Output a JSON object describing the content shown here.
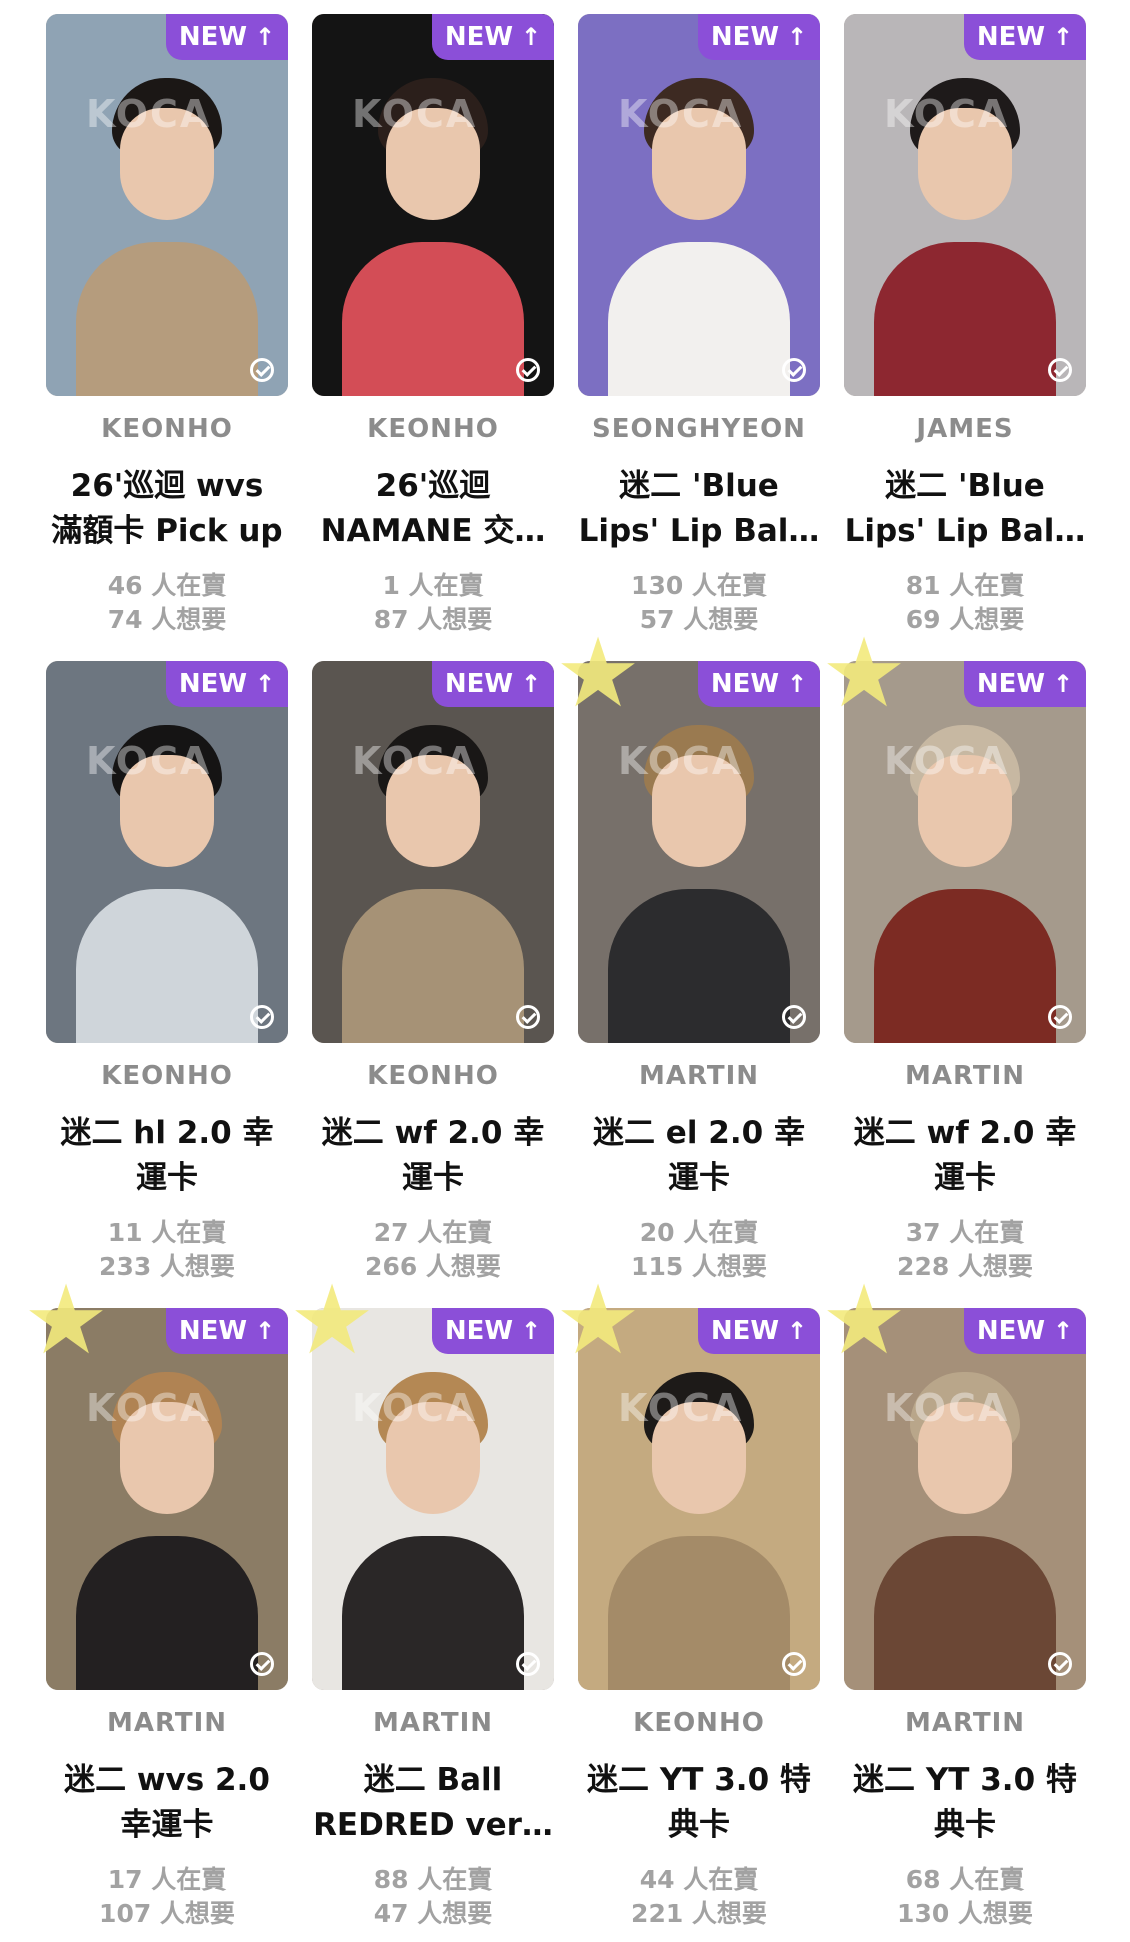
{
  "cards": [
    {
      "member": "KEONHO",
      "title": "26'巡迴 wvs\n滿額卡 Pick up",
      "selling": "46 人在賣",
      "wanting": "74 人想要",
      "badge": "NEW",
      "star": false,
      "palette": {
        "bg": "#8fa3b4",
        "hair": "#1b1715",
        "body": "#b59c7d"
      }
    },
    {
      "member": "KEONHO",
      "title": "26'巡迴\nNAMANE 交…",
      "selling": "1 人在賣",
      "wanting": "87 人想要",
      "badge": "NEW",
      "star": false,
      "palette": {
        "bg": "#141414",
        "hair": "#2b1f1b",
        "body": "#d34d56"
      }
    },
    {
      "member": "SEONGHYEON",
      "title": "迷二 'Blue\nLips' Lip Bal…",
      "selling": "130 人在賣",
      "wanting": "57 人想要",
      "badge": "NEW",
      "star": false,
      "palette": {
        "bg": "#7c6fc2",
        "hair": "#3d2a22",
        "body": "#f2f0ee"
      }
    },
    {
      "member": "JAMES",
      "title": "迷二 'Blue\nLips' Lip Bal…",
      "selling": "81 人在賣",
      "wanting": "69 人想要",
      "badge": "NEW",
      "star": false,
      "palette": {
        "bg": "#b9b6b8",
        "hair": "#1e1a1a",
        "body": "#8d2730"
      }
    },
    {
      "member": "KEONHO",
      "title": "迷二 hl 2.0 幸\n運卡",
      "selling": "11 人在賣",
      "wanting": "233 人想要",
      "badge": "NEW",
      "star": false,
      "palette": {
        "bg": "#6d7680",
        "hair": "#151414",
        "body": "#cfd5da"
      }
    },
    {
      "member": "KEONHO",
      "title": "迷二 wf 2.0 幸\n運卡",
      "selling": "27 人在賣",
      "wanting": "266 人想要",
      "badge": "NEW",
      "star": false,
      "palette": {
        "bg": "#5a5550",
        "hair": "#191716",
        "body": "#a69276"
      }
    },
    {
      "member": "MARTIN",
      "title": "迷二 el 2.0 幸\n運卡",
      "selling": "20 人在賣",
      "wanting": "115 人想要",
      "badge": "NEW",
      "star": true,
      "palette": {
        "bg": "#77706a",
        "hair": "#9a7a50",
        "body": "#2c2c2e"
      }
    },
    {
      "member": "MARTIN",
      "title": "迷二 wf 2.0 幸\n運卡",
      "selling": "37 人在賣",
      "wanting": "228 人想要",
      "badge": "NEW",
      "star": true,
      "palette": {
        "bg": "#a59a8c",
        "hair": "#c7b8a2",
        "body": "#7c2b23"
      }
    },
    {
      "member": "MARTIN",
      "title": "迷二 wvs 2.0\n幸運卡",
      "selling": "17 人在賣",
      "wanting": "107 人想要",
      "badge": "NEW",
      "star": true,
      "palette": {
        "bg": "#8b7c65",
        "hair": "#b08353",
        "body": "#232021"
      }
    },
    {
      "member": "MARTIN",
      "title": "迷二 Ball\nREDRED ver…",
      "selling": "88 人在賣",
      "wanting": "47 人想要",
      "badge": "NEW",
      "star": true,
      "palette": {
        "bg": "#e8e6e2",
        "hair": "#b48854",
        "body": "#2a2727"
      }
    },
    {
      "member": "KEONHO",
      "title": "迷二 YT 3.0 特\n典卡",
      "selling": "44 人在賣",
      "wanting": "221 人想要",
      "badge": "NEW",
      "star": true,
      "palette": {
        "bg": "#c4aa80",
        "hair": "#1d1a18",
        "body": "#a48b68"
      }
    },
    {
      "member": "MARTIN",
      "title": "迷二 YT 3.0 特\n典卡",
      "selling": "68 人在賣",
      "wanting": "130 人想要",
      "badge": "NEW",
      "star": true,
      "palette": {
        "bg": "#a59079",
        "hair": "#b9a68a",
        "body": "#6b4735"
      }
    }
  ],
  "watermark": "KOCA",
  "badge_arrow": "↑",
  "colors": {
    "badge": "#8b4fd8",
    "member_text": "#8c8c8c",
    "stat_text": "#a2a2a2",
    "star": "#f3ea7d"
  }
}
